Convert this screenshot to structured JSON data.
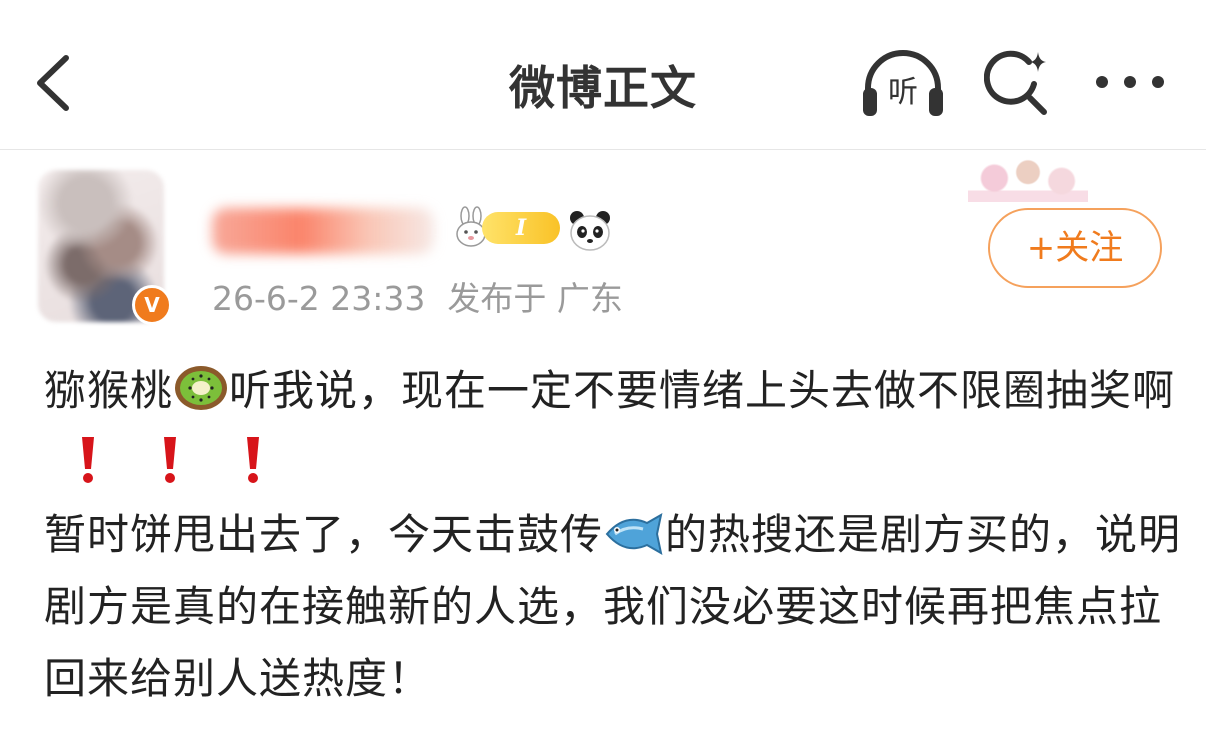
{
  "nav": {
    "title": "微博正文",
    "listen_label": "听",
    "icons": [
      "back-chevron-icon",
      "headphones-listen-icon",
      "search-sparkle-icon",
      "more-dots-icon"
    ]
  },
  "post": {
    "author": {
      "avatar": "blurred-avatar",
      "verified": "V",
      "level": "I",
      "badges": [
        "rabbit-icon",
        "level-badge",
        "panda-icon"
      ]
    },
    "timestamp": "26-6-2 23:33",
    "location": "发布于 广东",
    "follow_label": "+关注",
    "body": {
      "p1_a": "猕猴桃",
      "p1_b": "听我说，现在一定不要情绪上头去做不限圈抽奖啊",
      "p2_a": "暂时饼甩出去了，今天击鼓传",
      "p2_b": "的热搜还是剧方买的，说明剧方是真的在接触新的人选，我们没必要这时候再把焦点拉回来给别人送热度！",
      "emojis": [
        "kiwi-emoji",
        "exclamation-emoji",
        "fish-emoji"
      ]
    }
  },
  "colors": {
    "accent": "#f07b1d",
    "meta": "#9a9a9a",
    "text": "#222222",
    "exclaim": "#d7141a"
  }
}
